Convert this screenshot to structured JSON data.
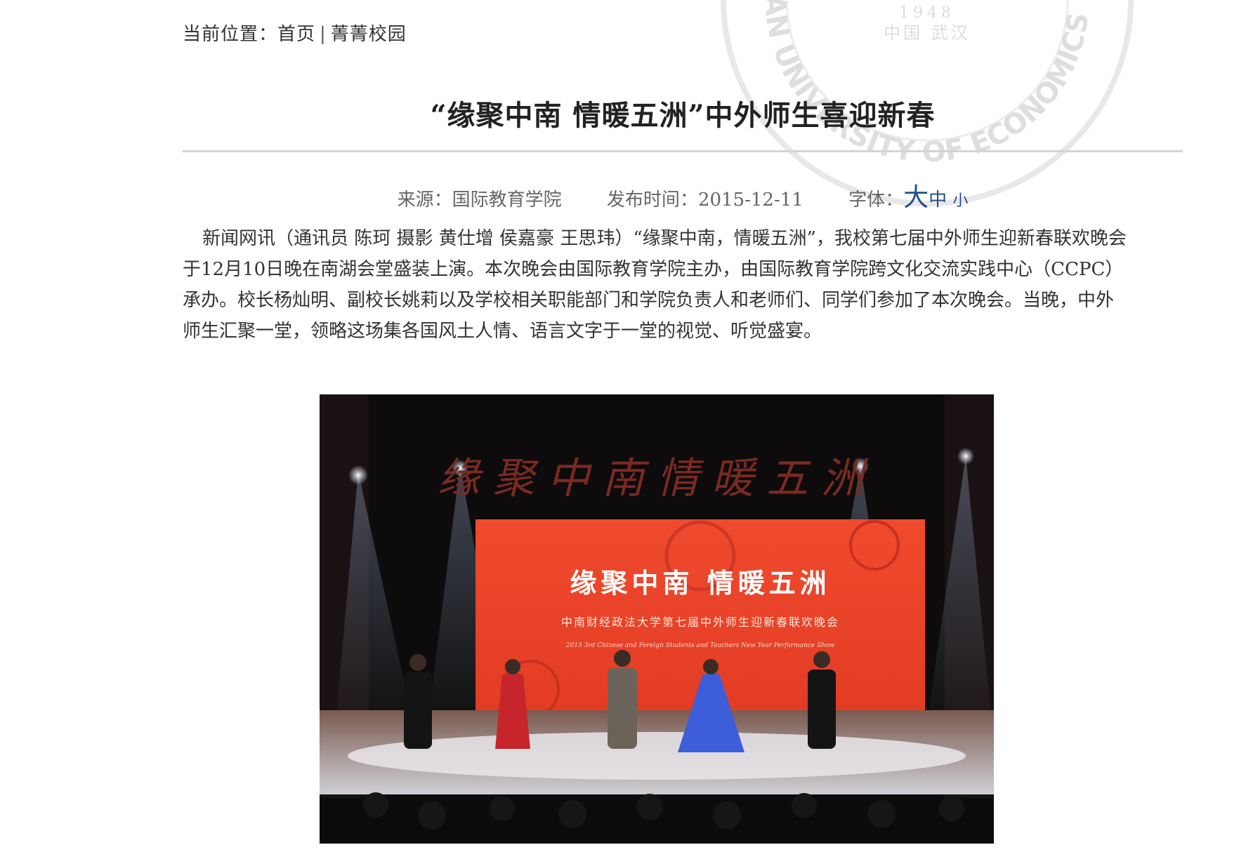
{
  "breadcrumb": {
    "label": "当前位置：",
    "home": "首页",
    "separator": "|",
    "current": "菁菁校园"
  },
  "watermark": {
    "year": "1948",
    "city": "中国 武汉",
    "text": "ZHONGNAN UNIVERSITY OF ECONOMICS AND LAW"
  },
  "article": {
    "title": "“缘聚中南 情暖五洲”中外师生喜迎新春",
    "source_label": "来源：",
    "source": "国际教育学院",
    "date_label": "发布时间：",
    "date": "2015-12-11",
    "font_label": "字体：",
    "font_large": "大",
    "font_medium": "中",
    "font_small": "小",
    "body": "新闻网讯（通讯员 陈珂 摄影 黄仕增 侯嘉豪 王思玮）“缘聚中南，情暖五洲”，我校第七届中外师生迎新春联欢晚会于12月10日晚在南湖会堂盛装上演。本次晚会由国际教育学院主办，由国际教育学院跨文化交流实践中心（CCPC）承办。校长杨灿明、副校长姚莉以及学校相关职能部门和学院负责人和老师们、同学们参加了本次晚会。当晚，中外师生汇聚一堂，领略这场集各国风土人情、语言文字于一堂的视觉、听觉盛宴。"
  },
  "photo": {
    "overhead_text": "缘聚中南情暖五洲",
    "screen_title": "缘聚中南 情暖五洲",
    "screen_subtitle": "中南财经政法大学第七届中外师生迎新春联欢晚会",
    "screen_english": "2015 3rd Chinese and Foreign Students and Teachers New Year Performance Show"
  },
  "colors": {
    "link_blue": "#1f4e8c",
    "rule": "#d4d4d4",
    "screen_red": "#e8452a"
  }
}
